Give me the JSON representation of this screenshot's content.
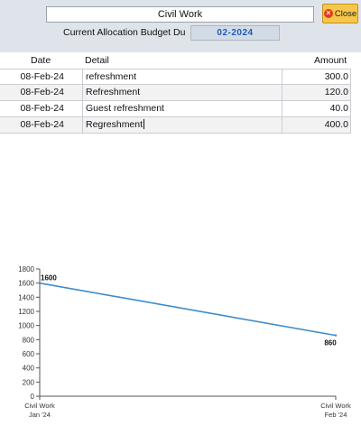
{
  "header": {
    "title_value": "Civil Work",
    "close_label": "Close",
    "budget_label": "Current Allocation Budget Du",
    "budget_period": "02-2024"
  },
  "grid": {
    "columns": [
      "Date",
      "Detail",
      "Amount"
    ],
    "rows": [
      {
        "date": "08-Feb-24",
        "detail": "refreshment",
        "amount": "300.0"
      },
      {
        "date": "08-Feb-24",
        "detail": "Refreshment",
        "amount": "120.0"
      },
      {
        "date": "08-Feb-24",
        "detail": "Guest refreshment",
        "amount": "40.0"
      },
      {
        "date": "08-Feb-24",
        "detail": "Regreshment",
        "amount": "400.0"
      }
    ]
  },
  "chart_data": {
    "type": "line",
    "x": [
      "Civil Work\nJan '24",
      "Civil Work\nFeb '24"
    ],
    "categories": [
      [
        "Civil Work",
        "Jan '24"
      ],
      [
        "Civil Work",
        "Feb '24"
      ]
    ],
    "series": [
      {
        "values": [
          1600,
          860
        ],
        "color": "#3f8bc9"
      }
    ],
    "data_labels": [
      "1600",
      "860"
    ],
    "ylim": [
      0,
      1800
    ],
    "yticks": [
      0,
      200,
      400,
      600,
      800,
      1000,
      1200,
      1400,
      1600,
      1800
    ],
    "grid": false
  }
}
